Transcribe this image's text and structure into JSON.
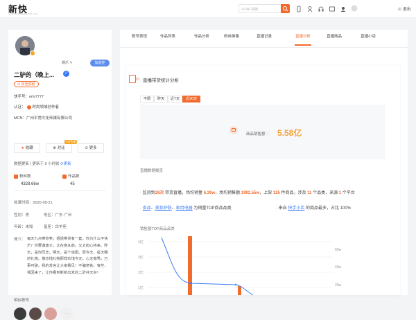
{
  "topbar": {
    "logo": "新快",
    "logo_sub": "XINKUAI.NEWRANK.CN",
    "search_placeholder": "KUAI·快搜",
    "logout": "退出"
  },
  "profile": {
    "category": "娱乐",
    "follow_label": "加监控",
    "name": "二驴的（晚上...",
    "history_badge": "历史成就",
    "kuaishou_id": "快手号：erlv7777",
    "cert_label": "认证：",
    "cert_text": "时尚领域创作者",
    "mcn": "MCN：广州平常文化传媒有限公司",
    "actions": [
      "收藏",
      "对比",
      "更多"
    ],
    "compare_badge": "VIP专享",
    "data_update_label": "数据更新 | 更新于 9 小时前",
    "update_link": "更新",
    "fans_label": "粉丝数",
    "fans_value": "4328.66w",
    "works_label": "作品数",
    "works_value": "45",
    "registered": "收录时间：2020-05-21",
    "gender": "性别：男",
    "region": "地区：广东·广州",
    "age": "年龄：未知",
    "constellation": "星座：白羊座",
    "bio_label": "简介：",
    "bio": "每天九点带你笑，姐姐带货有一套。你为什么不快乐？你要谦虚大，太在意从前。又太担心将来。昨天，是你历史。明天，是个谜团。而今天，是天赐的礼物。像珍惜礼物那样珍惜今天。心无旁骛，万事可破。我的发言让大家看见！不骗老铁。有些，我因来了，让你看到新新出发的二驴并无杂！",
    "related_label": "相似账号"
  },
  "tabs": [
    "账号表现",
    "作品列表",
    "作品分析",
    "粉丝画像",
    "直播记录",
    "直播分析",
    "直播商品",
    "直播小店"
  ],
  "active_tab": 5,
  "live_analysis": {
    "section_num": "01",
    "section_title": "直播带货统计分析",
    "periods": [
      "不限",
      "昨天",
      "近7天",
      "近30天"
    ],
    "active_period": 3,
    "sales_label": "商品销售额",
    "sales_value": "5.58亿",
    "overview_title": "直播数据概览",
    "summary_line1": {
      "p1": "监测到",
      "v1": "28次",
      "p2": " 带货直播，场均销量 ",
      "v2": "6.39w",
      "p3": "，场均销售额 ",
      "v3": "1992.55w",
      "p4": "，上架 ",
      "v4": "125",
      "p5": " 件商品，涉及 ",
      "v5": "11",
      "p6": " 个品类，来源 ",
      "v6": "1",
      "p7": " 个平台"
    },
    "summary_line2": {
      "c1": "食品",
      "c2": "美妆护肤",
      "c3": "家用电器",
      "p1": " 为销量TOP商品品类",
      "p2": "· 来自 ",
      "c4": "快手小店",
      "p3": " 的商品最多，占比 100%"
    },
    "chart_title": "销售额TOP商品品类"
  },
  "chart_data": {
    "type": "bar",
    "y_ticks_left": [
      "4亿",
      "3亿",
      "2亿",
      "1亿"
    ],
    "y_ticks_right": [
      "60w",
      "40w",
      "20w"
    ],
    "bars": [
      4.0,
      0.45
    ],
    "line": [
      57,
      25,
      21,
      20
    ]
  },
  "colors": {
    "accent": "#f36a2d",
    "blue": "#3a7bf6",
    "sales": "#f4a23a"
  }
}
